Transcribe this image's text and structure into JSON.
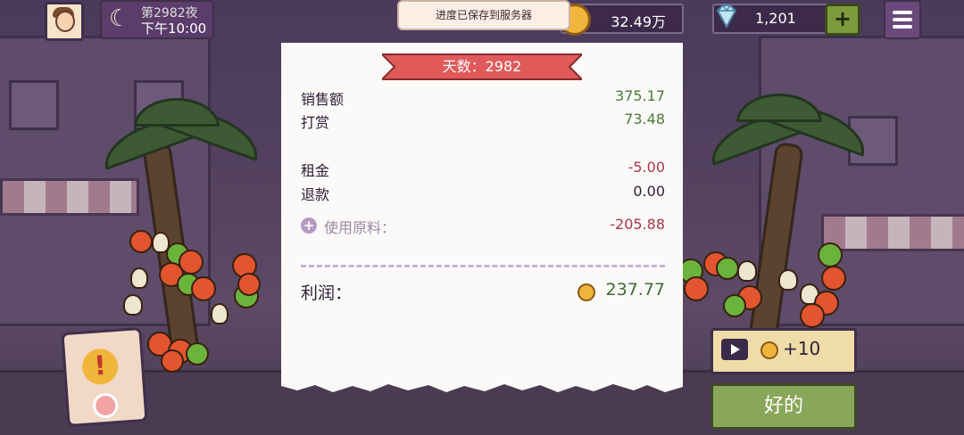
{
  "hud": {
    "night_label": "第2982夜",
    "time_label": "下午10:00",
    "toast": "进度已保存到服务器",
    "coins": "32.49万",
    "gems": "1,201",
    "add_label": "+",
    "moon_icon": "moon-icon",
    "menu_icon": "hamburger-icon"
  },
  "receipt": {
    "day_title": "天数：2982",
    "rows": [
      {
        "label": "销售额",
        "value": "375.17",
        "tone": "positive"
      },
      {
        "label": "打赏",
        "value": "73.48",
        "tone": "positive"
      },
      {
        "label": "租金",
        "value": "-5.00",
        "tone": "negative"
      },
      {
        "label": "退款",
        "value": "0.00",
        "tone": "neutral"
      }
    ],
    "materials": {
      "label": "使用原料：",
      "value": "-205.88"
    },
    "profit": {
      "label": "利润：",
      "value": "237.77"
    }
  },
  "buttons": {
    "ad_reward": "+10",
    "ok": "好的"
  },
  "colors": {
    "positive": "#4a7a3a",
    "negative": "#a8364a",
    "ribbon": "#e05a5a"
  }
}
